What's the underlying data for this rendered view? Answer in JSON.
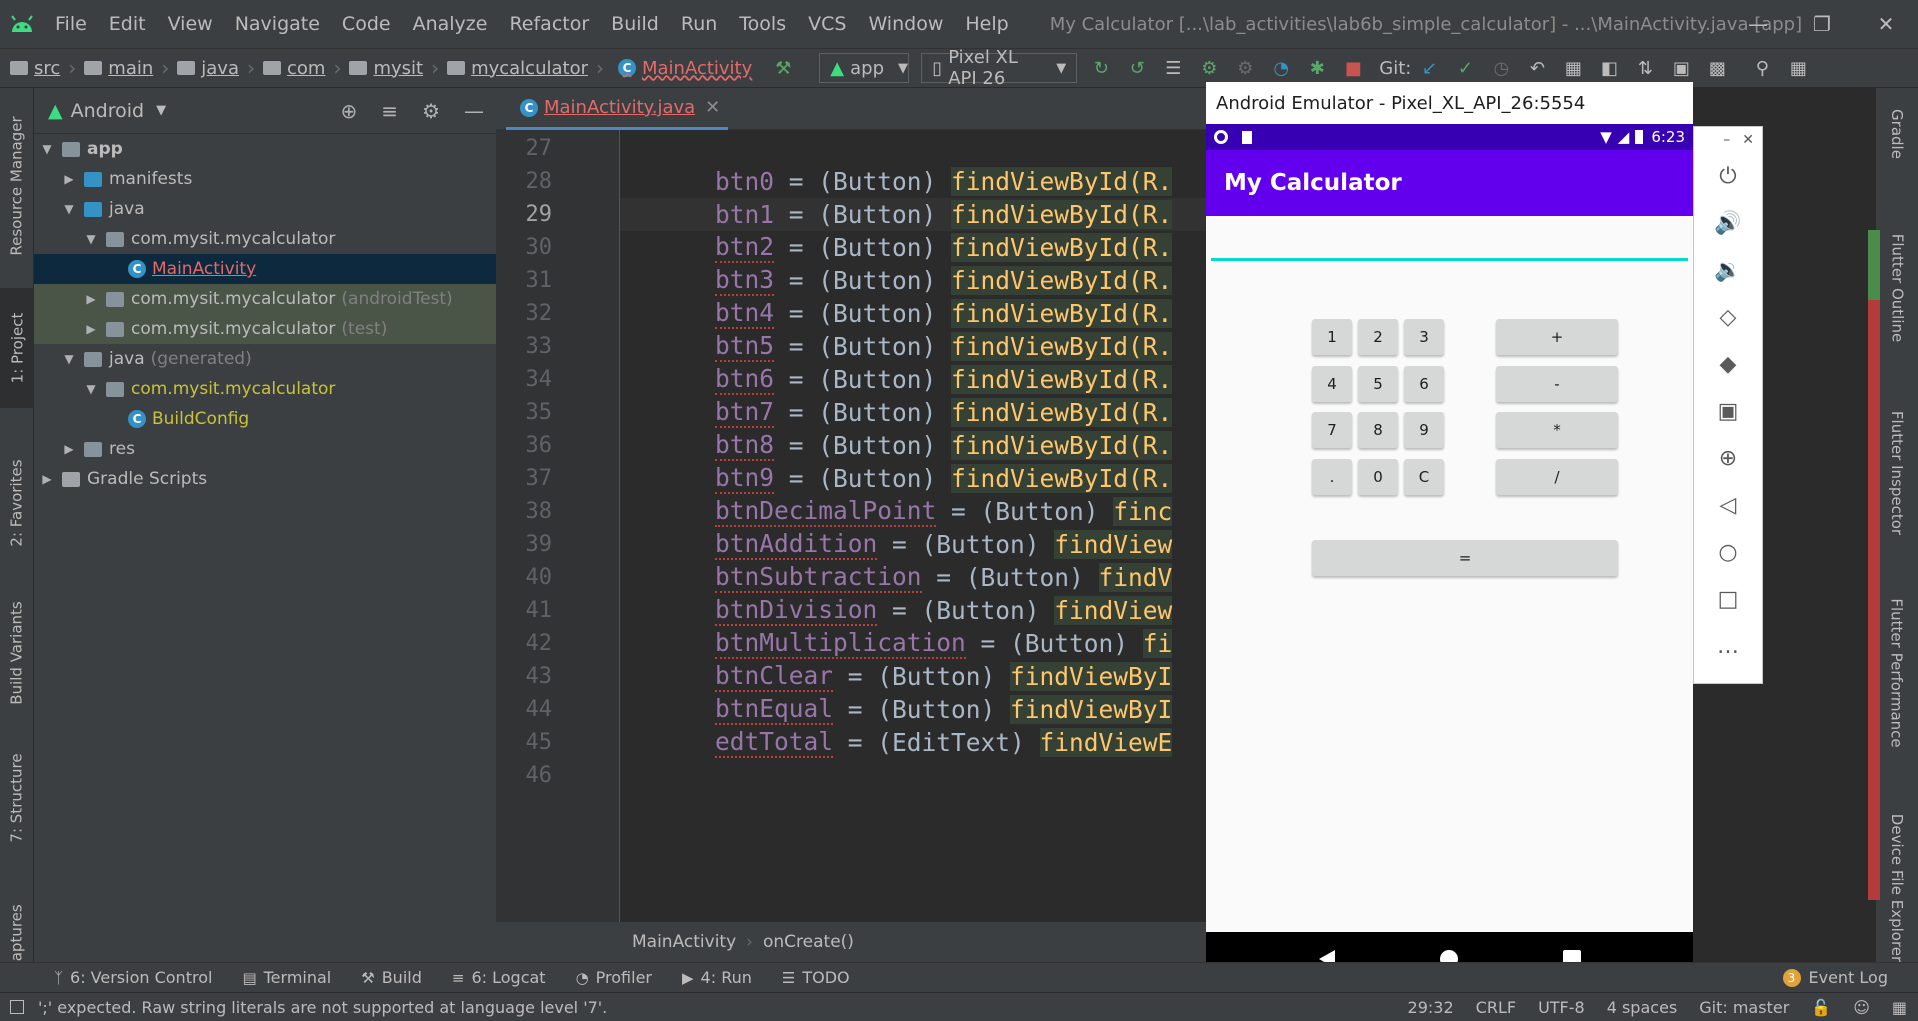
{
  "menubar": {
    "items": [
      "File",
      "Edit",
      "View",
      "Navigate",
      "Code",
      "Analyze",
      "Refactor",
      "Build",
      "Run",
      "Tools",
      "VCS",
      "Window",
      "Help"
    ],
    "title": "My Calculator [...\\lab_activities\\lab6b_simple_calculator] - ...\\MainActivity.java [app]"
  },
  "breadcrumbs": [
    "src",
    "main",
    "java",
    "com",
    "mysit",
    "mycalculator",
    "MainActivity"
  ],
  "toolbar": {
    "run_config": "app",
    "device": "Pixel XL API 26",
    "git_label": "Git:"
  },
  "left_tabs": [
    "Resource Manager",
    "1: Project",
    "2: Favorites",
    "Build Variants",
    "7: Structure",
    "Captures"
  ],
  "project": {
    "view_label": "Android",
    "tree": [
      {
        "label": "app",
        "depth": 0,
        "expanded": true,
        "icon": "module-folder-icon",
        "bold": true
      },
      {
        "label": "manifests",
        "depth": 1,
        "expanded": false,
        "icon": "folder-icon"
      },
      {
        "label": "java",
        "depth": 1,
        "expanded": true,
        "icon": "folder-icon"
      },
      {
        "label": "com.mysit.mycalculator",
        "depth": 2,
        "expanded": true,
        "icon": "package-icon"
      },
      {
        "label": "MainActivity",
        "depth": 3,
        "icon": "class-icon",
        "selected": true
      },
      {
        "label": "com.mysit.mycalculator",
        "suffix": "(androidTest)",
        "depth": 2,
        "expanded": false,
        "icon": "package-icon",
        "hl": true
      },
      {
        "label": "com.mysit.mycalculator",
        "suffix": "(test)",
        "depth": 2,
        "expanded": false,
        "icon": "package-icon",
        "hl": true
      },
      {
        "label": "java",
        "suffix": "(generated)",
        "depth": 1,
        "expanded": true,
        "icon": "generated-folder-icon"
      },
      {
        "label": "com.mysit.mycalculator",
        "depth": 2,
        "expanded": true,
        "icon": "package-icon",
        "yellow": true
      },
      {
        "label": "BuildConfig",
        "depth": 3,
        "icon": "class-icon",
        "yellow": true
      },
      {
        "label": "res",
        "depth": 1,
        "expanded": false,
        "icon": "res-folder-icon"
      },
      {
        "label": "Gradle Scripts",
        "depth": 0,
        "expanded": false,
        "icon": "gradle-icon"
      }
    ]
  },
  "editor": {
    "tab_label": "MainActivity.java",
    "current_line": 29,
    "lines": [
      {
        "n": "27",
        "var": "",
        "rest": "",
        "fn": ""
      },
      {
        "n": "28",
        "var": "btn0",
        "rest": " = (Button) ",
        "fn": "findViewById(R."
      },
      {
        "n": "29",
        "var": "btn1",
        "rest": " = (Button) ",
        "fn": "findViewById(R."
      },
      {
        "n": "30",
        "var": "btn2",
        "rest": " = (Button) ",
        "fn": "findViewById(R."
      },
      {
        "n": "31",
        "var": "btn3",
        "rest": " = (Button) ",
        "fn": "findViewById(R."
      },
      {
        "n": "32",
        "var": "btn4",
        "rest": " = (Button) ",
        "fn": "findViewById(R."
      },
      {
        "n": "33",
        "var": "btn5",
        "rest": " = (Button) ",
        "fn": "findViewById(R."
      },
      {
        "n": "34",
        "var": "btn6",
        "rest": " = (Button) ",
        "fn": "findViewById(R."
      },
      {
        "n": "35",
        "var": "btn7",
        "rest": " = (Button) ",
        "fn": "findViewById(R."
      },
      {
        "n": "36",
        "var": "btn8",
        "rest": " = (Button) ",
        "fn": "findViewById(R."
      },
      {
        "n": "37",
        "var": "btn9",
        "rest": " = (Button) ",
        "fn": "findViewById(R."
      },
      {
        "n": "38",
        "var": "btnDecimalPoint",
        "rest": " = (Button) ",
        "fn": "finc"
      },
      {
        "n": "39",
        "var": "btnAddition",
        "rest": " = (Button) ",
        "fn": "findView"
      },
      {
        "n": "40",
        "var": "btnSubtraction",
        "rest": " = (Button) ",
        "fn": "findV"
      },
      {
        "n": "41",
        "var": "btnDivision",
        "rest": " = (Button) ",
        "fn": "findView"
      },
      {
        "n": "42",
        "var": "btnMultiplication",
        "rest": " = (Button) ",
        "fn": "fi"
      },
      {
        "n": "43",
        "var": "btnClear",
        "rest": " = (Button) ",
        "fn": "findViewByI"
      },
      {
        "n": "44",
        "var": "btnEqual",
        "rest": " = (Button) ",
        "fn": "findViewByI"
      },
      {
        "n": "45",
        "var": "edtTotal",
        "rest": " = (EditText) ",
        "fn": "findViewE"
      },
      {
        "n": "46",
        "var": "",
        "rest": "",
        "fn": ""
      }
    ],
    "breadcrumb": [
      "MainActivity",
      "onCreate()"
    ]
  },
  "emulator": {
    "window_title": "Android Emulator - Pixel_XL_API_26:5554",
    "status_time": "6:23",
    "app_title": "My Calculator",
    "digit_buttons": [
      "1",
      "2",
      "3",
      "4",
      "5",
      "6",
      "7",
      "8",
      "9",
      ".",
      "0",
      "C"
    ],
    "op_buttons": [
      "+",
      "-",
      "*",
      "/"
    ],
    "equals_button": "=",
    "controls": [
      "power-icon",
      "volume-up-icon",
      "volume-down-icon",
      "rotate-left-icon",
      "rotate-right-icon",
      "camera-icon",
      "zoom-icon",
      "back-icon",
      "home-icon",
      "overview-icon",
      "more-icon"
    ]
  },
  "right_tabs": [
    "Gradle",
    "Flutter Outline",
    "Flutter Inspector",
    "Flutter Performance",
    "Device File Explorer"
  ],
  "bottom_tools": [
    "6: Version Control",
    "Terminal",
    "Build",
    "6: Logcat",
    "Profiler",
    "4: Run",
    "TODO"
  ],
  "event_log": {
    "badge": "3",
    "label": "Event Log"
  },
  "status": {
    "message": "';' expected. Raw string literals are not supported at language level '7'.",
    "position": "29:32",
    "line_sep": "CRLF",
    "encoding": "UTF-8",
    "indent": "4 spaces",
    "git": "Git: master"
  }
}
